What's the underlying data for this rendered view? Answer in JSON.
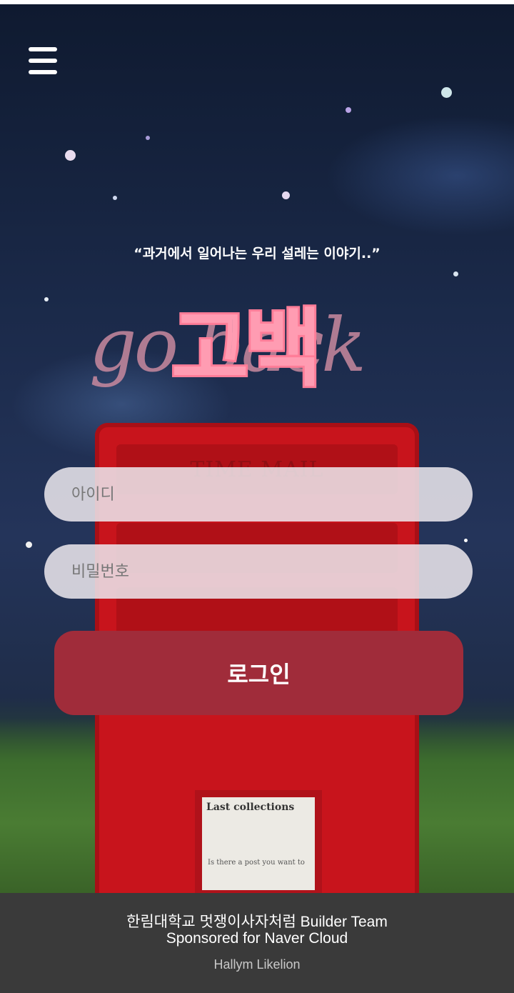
{
  "header": {
    "menu_icon": "hamburger-menu-icon"
  },
  "hero": {
    "tagline": "“과거에서 일어나는 우리 설레는 이야기..”",
    "logo_latin": "go back",
    "logo_korean": "고백"
  },
  "postbox": {
    "label": "TIME MAIL",
    "notice_title": "Last collections",
    "notice_line": "Is there a post you want to"
  },
  "form": {
    "id_placeholder": "아이디",
    "password_placeholder": "비밀번호",
    "login_label": "로그인"
  },
  "footer": {
    "line1": "한림대학교 멋쟁이사자처럼 Builder Team",
    "line2": "Sponsored for Naver Cloud",
    "line3": "Hallym Likelion"
  },
  "colors": {
    "login_button": "#a02c3a",
    "footer_bg": "#3a3a3a",
    "postbox_red": "#c8141c"
  }
}
